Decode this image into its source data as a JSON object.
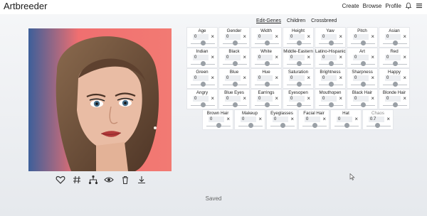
{
  "app": {
    "title": "Artbreeder"
  },
  "nav": {
    "create": "Create",
    "browse": "Browse",
    "profile": "Profile",
    "bell_icon": "bell-icon",
    "menu_icon": "hamburger-menu-icon"
  },
  "tabs": [
    {
      "label": "Edit-Genes",
      "active": true
    },
    {
      "label": "Children",
      "active": false
    },
    {
      "label": "Crossbreed",
      "active": false
    }
  ],
  "genes": [
    {
      "label": "Age",
      "value": "0"
    },
    {
      "label": "Gender",
      "value": "0"
    },
    {
      "label": "Width",
      "value": "0"
    },
    {
      "label": "Height",
      "value": "0"
    },
    {
      "label": "Yaw",
      "value": "0"
    },
    {
      "label": "Pitch",
      "value": "0"
    },
    {
      "label": "Asian",
      "value": "0"
    },
    {
      "label": "Indian",
      "value": "0"
    },
    {
      "label": "Black",
      "value": "0"
    },
    {
      "label": "White",
      "value": "0"
    },
    {
      "label": "Middle-Eastern",
      "value": "0"
    },
    {
      "label": "Latino-Hispanic",
      "value": "0"
    },
    {
      "label": "Art",
      "value": "0"
    },
    {
      "label": "Red",
      "value": "0"
    },
    {
      "label": "Green",
      "value": "0"
    },
    {
      "label": "Blue",
      "value": "0"
    },
    {
      "label": "Hue",
      "value": "0"
    },
    {
      "label": "Saturation",
      "value": "0"
    },
    {
      "label": "Brightness",
      "value": "0"
    },
    {
      "label": "Sharpness",
      "value": "0"
    },
    {
      "label": "Happy",
      "value": "0"
    },
    {
      "label": "Angry",
      "value": "0"
    },
    {
      "label": "Blue Eyes",
      "value": "0"
    },
    {
      "label": "Earrings",
      "value": "0"
    },
    {
      "label": "Eyesopen",
      "value": "0"
    },
    {
      "label": "Mouthopen",
      "value": "0"
    },
    {
      "label": "Black Hair",
      "value": "0"
    },
    {
      "label": "Blonde Hair",
      "value": "0"
    },
    {
      "label": "Brown Hair",
      "value": "0"
    },
    {
      "label": "Makeup",
      "value": "0"
    },
    {
      "label": "Eyeglasses",
      "value": "0"
    },
    {
      "label": "Facial Hair",
      "value": "0"
    },
    {
      "label": "Hat",
      "value": "0"
    },
    {
      "label": "Chaos",
      "value": "0.7",
      "dim": true
    }
  ],
  "actions": [
    {
      "name": "heart-icon"
    },
    {
      "name": "hashtag-icon"
    },
    {
      "name": "family-tree-icon"
    },
    {
      "name": "eye-icon"
    },
    {
      "name": "trash-icon"
    },
    {
      "name": "download-icon"
    }
  ],
  "status": {
    "saved": "Saved"
  },
  "colors": {
    "portrait_background": "#f06f70",
    "hair": "#6b4a33",
    "skin": "#e8b9a0",
    "lips": "#b23a3a",
    "eyes": "#4a6f8a"
  }
}
